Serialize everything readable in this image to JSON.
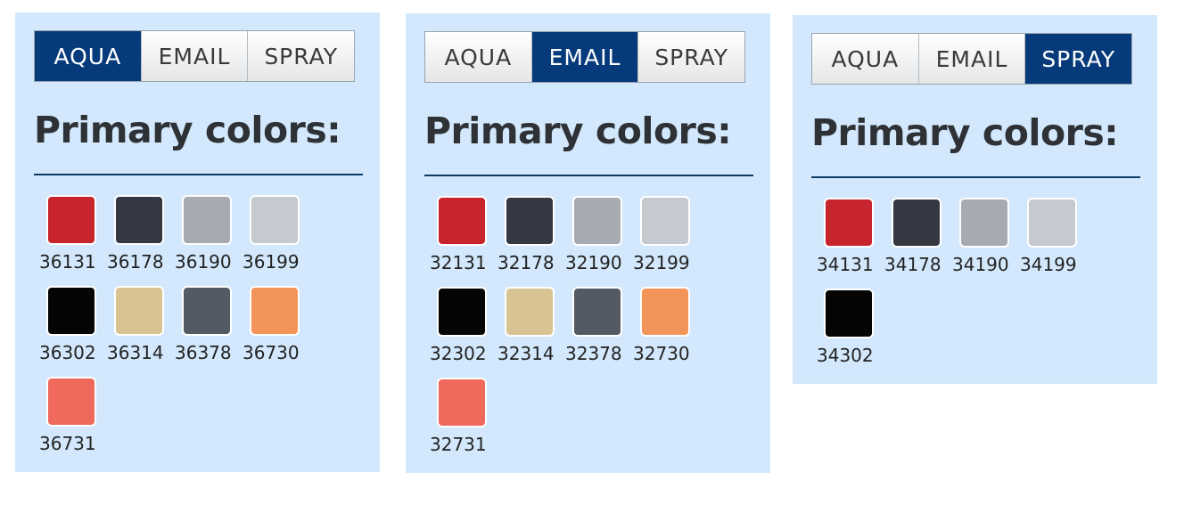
{
  "panels": [
    {
      "tabs": [
        "AQUA",
        "EMAIL",
        "SPRAY"
      ],
      "active_tab": 0,
      "heading": "Primary colors:",
      "swatches": [
        {
          "code": "36131",
          "color": "#c8242e"
        },
        {
          "code": "36178",
          "color": "#333842"
        },
        {
          "code": "36190",
          "color": "#a7abb1"
        },
        {
          "code": "36199",
          "color": "#c5cad0"
        },
        {
          "code": "36302",
          "color": "#050505"
        },
        {
          "code": "36314",
          "color": "#d8c493"
        },
        {
          "code": "36378",
          "color": "#545a63"
        },
        {
          "code": "36730",
          "color": "#f3955a"
        },
        {
          "code": "36731",
          "color": "#ef695d"
        }
      ]
    },
    {
      "tabs": [
        "AQUA",
        "EMAIL",
        "SPRAY"
      ],
      "active_tab": 1,
      "heading": "Primary colors:",
      "swatches": [
        {
          "code": "32131",
          "color": "#c8242e"
        },
        {
          "code": "32178",
          "color": "#333842"
        },
        {
          "code": "32190",
          "color": "#a7abb1"
        },
        {
          "code": "32199",
          "color": "#c5cad0"
        },
        {
          "code": "32302",
          "color": "#050505"
        },
        {
          "code": "32314",
          "color": "#d8c493"
        },
        {
          "code": "32378",
          "color": "#545a63"
        },
        {
          "code": "32730",
          "color": "#f3955a"
        },
        {
          "code": "32731",
          "color": "#ef695d"
        }
      ]
    },
    {
      "tabs": [
        "AQUA",
        "EMAIL",
        "SPRAY"
      ],
      "active_tab": 2,
      "heading": "Primary colors:",
      "swatches": [
        {
          "code": "34131",
          "color": "#c8242e"
        },
        {
          "code": "34178",
          "color": "#333842"
        },
        {
          "code": "34190",
          "color": "#a7abb1"
        },
        {
          "code": "34199",
          "color": "#c5cad0"
        },
        {
          "code": "34302",
          "color": "#050505"
        }
      ]
    }
  ],
  "colors": {
    "panel_background": "#d3e8fc",
    "active_tab": "#063a7a",
    "rule": "#0e3a63"
  }
}
